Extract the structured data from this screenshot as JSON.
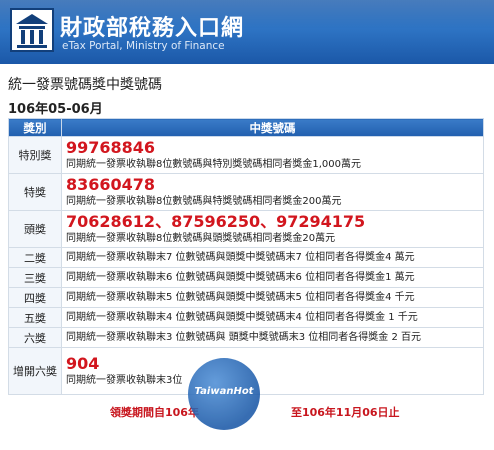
{
  "header": {
    "title": "財政部稅務入口網",
    "subtitle": "eTax Portal, Ministry of Finance"
  },
  "page": {
    "heading": "統一發票號碼獎中獎號碼",
    "period": "106年05-06月"
  },
  "table": {
    "headers": [
      "獎別",
      "中獎號碼"
    ],
    "rows": [
      {
        "category": "特別獎",
        "number": "99768846",
        "desc": "同期統一發票收執聯8位數號碼與特別獎號碼相同者獎金1,000萬元"
      },
      {
        "category": "特獎",
        "number": "83660478",
        "desc": "同期統一發票收執聯8位數號碼與特獎號碼相同者獎金200萬元"
      },
      {
        "category": "頭獎",
        "number": "70628612、87596250、97294175",
        "desc": "同期統一發票收執聯8位數號碼與頭獎號碼相同者獎金20萬元"
      },
      {
        "category": "二獎",
        "desc": "同期統一發票收執聯末7 位數號碼與頭獎中獎號碼末7 位相同者各得獎金4 萬元"
      },
      {
        "category": "三獎",
        "desc": "同期統一發票收執聯末6 位數號碼與頭獎中獎號碼末6 位相同者各得獎金1 萬元"
      },
      {
        "category": "四獎",
        "desc": "同期統一發票收執聯末5 位數號碼與頭獎中獎號碼末5 位相同者各得獎金4 千元"
      },
      {
        "category": "五獎",
        "desc": "同期統一發票收執聯末4 位數號碼與頭獎中獎號碼末4 位相同者各得獎金 1 千元"
      },
      {
        "category": "六獎",
        "desc": "同期統一發票收執聯末3 位數號碼與 頭獎中獎號碼末3 位相同者各得獎金 2 百元"
      },
      {
        "category": "增開六獎",
        "number": "904",
        "desc": "同期統一發票收執聯末3位"
      }
    ]
  },
  "footer": {
    "note": "領獎期間自106年",
    "note_end": "至106年11月06日止"
  },
  "watermark": {
    "text": "TaiwanHot"
  },
  "colors": {
    "header_blue": "#1f5fae",
    "prize_red": "#d2161e"
  }
}
